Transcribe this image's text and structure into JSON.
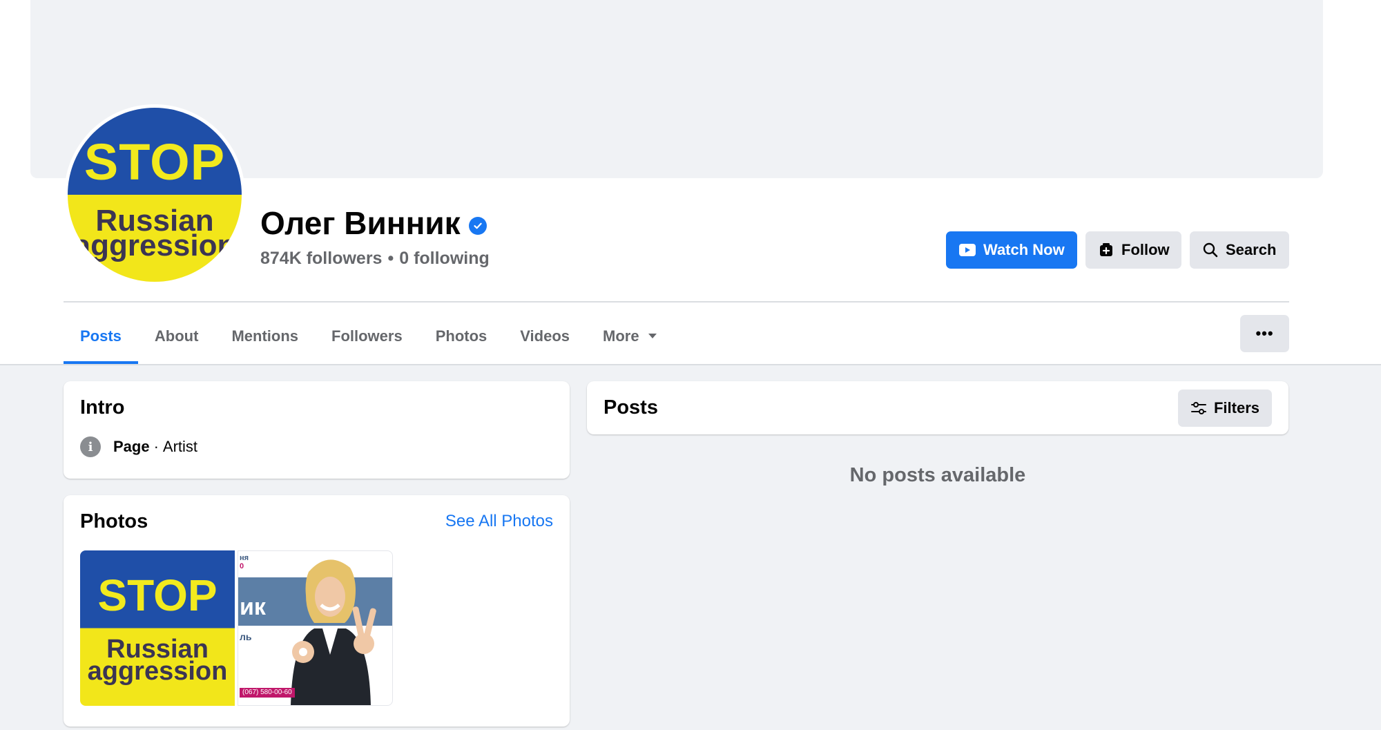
{
  "profile": {
    "name": "Олег Винник",
    "followers": "874K followers",
    "separator": "•",
    "following": "0 following",
    "avatar_text": {
      "line1": "STOP",
      "line2": "Russian",
      "line3": "aggression"
    }
  },
  "actions": {
    "watch_now": "Watch Now",
    "follow": "Follow",
    "search": "Search"
  },
  "tabs": [
    {
      "label": "Posts",
      "active": true
    },
    {
      "label": "About"
    },
    {
      "label": "Mentions"
    },
    {
      "label": "Followers"
    },
    {
      "label": "Photos"
    },
    {
      "label": "Videos"
    },
    {
      "label": "More"
    }
  ],
  "more_dots": "•••",
  "intro": {
    "title": "Intro",
    "category_type": "Page",
    "separator": "·",
    "category": "Artist"
  },
  "photos": {
    "title": "Photos",
    "see_all": "See All Photos",
    "thumb1_text": {
      "line1": "STOP",
      "line2": "Russian",
      "line3": "aggression"
    },
    "thumb2_text": {
      "frag1": "ня",
      "frag2": "0",
      "frag3": "ик",
      "frag4": "ль",
      "phone": "(067) 580-00-60"
    }
  },
  "posts": {
    "title": "Posts",
    "filters": "Filters",
    "empty": "No posts available"
  },
  "colors": {
    "accent": "#1877f2",
    "ukraine_blue": "#1f4fa8",
    "ukraine_yellow": "#f2e61a"
  }
}
